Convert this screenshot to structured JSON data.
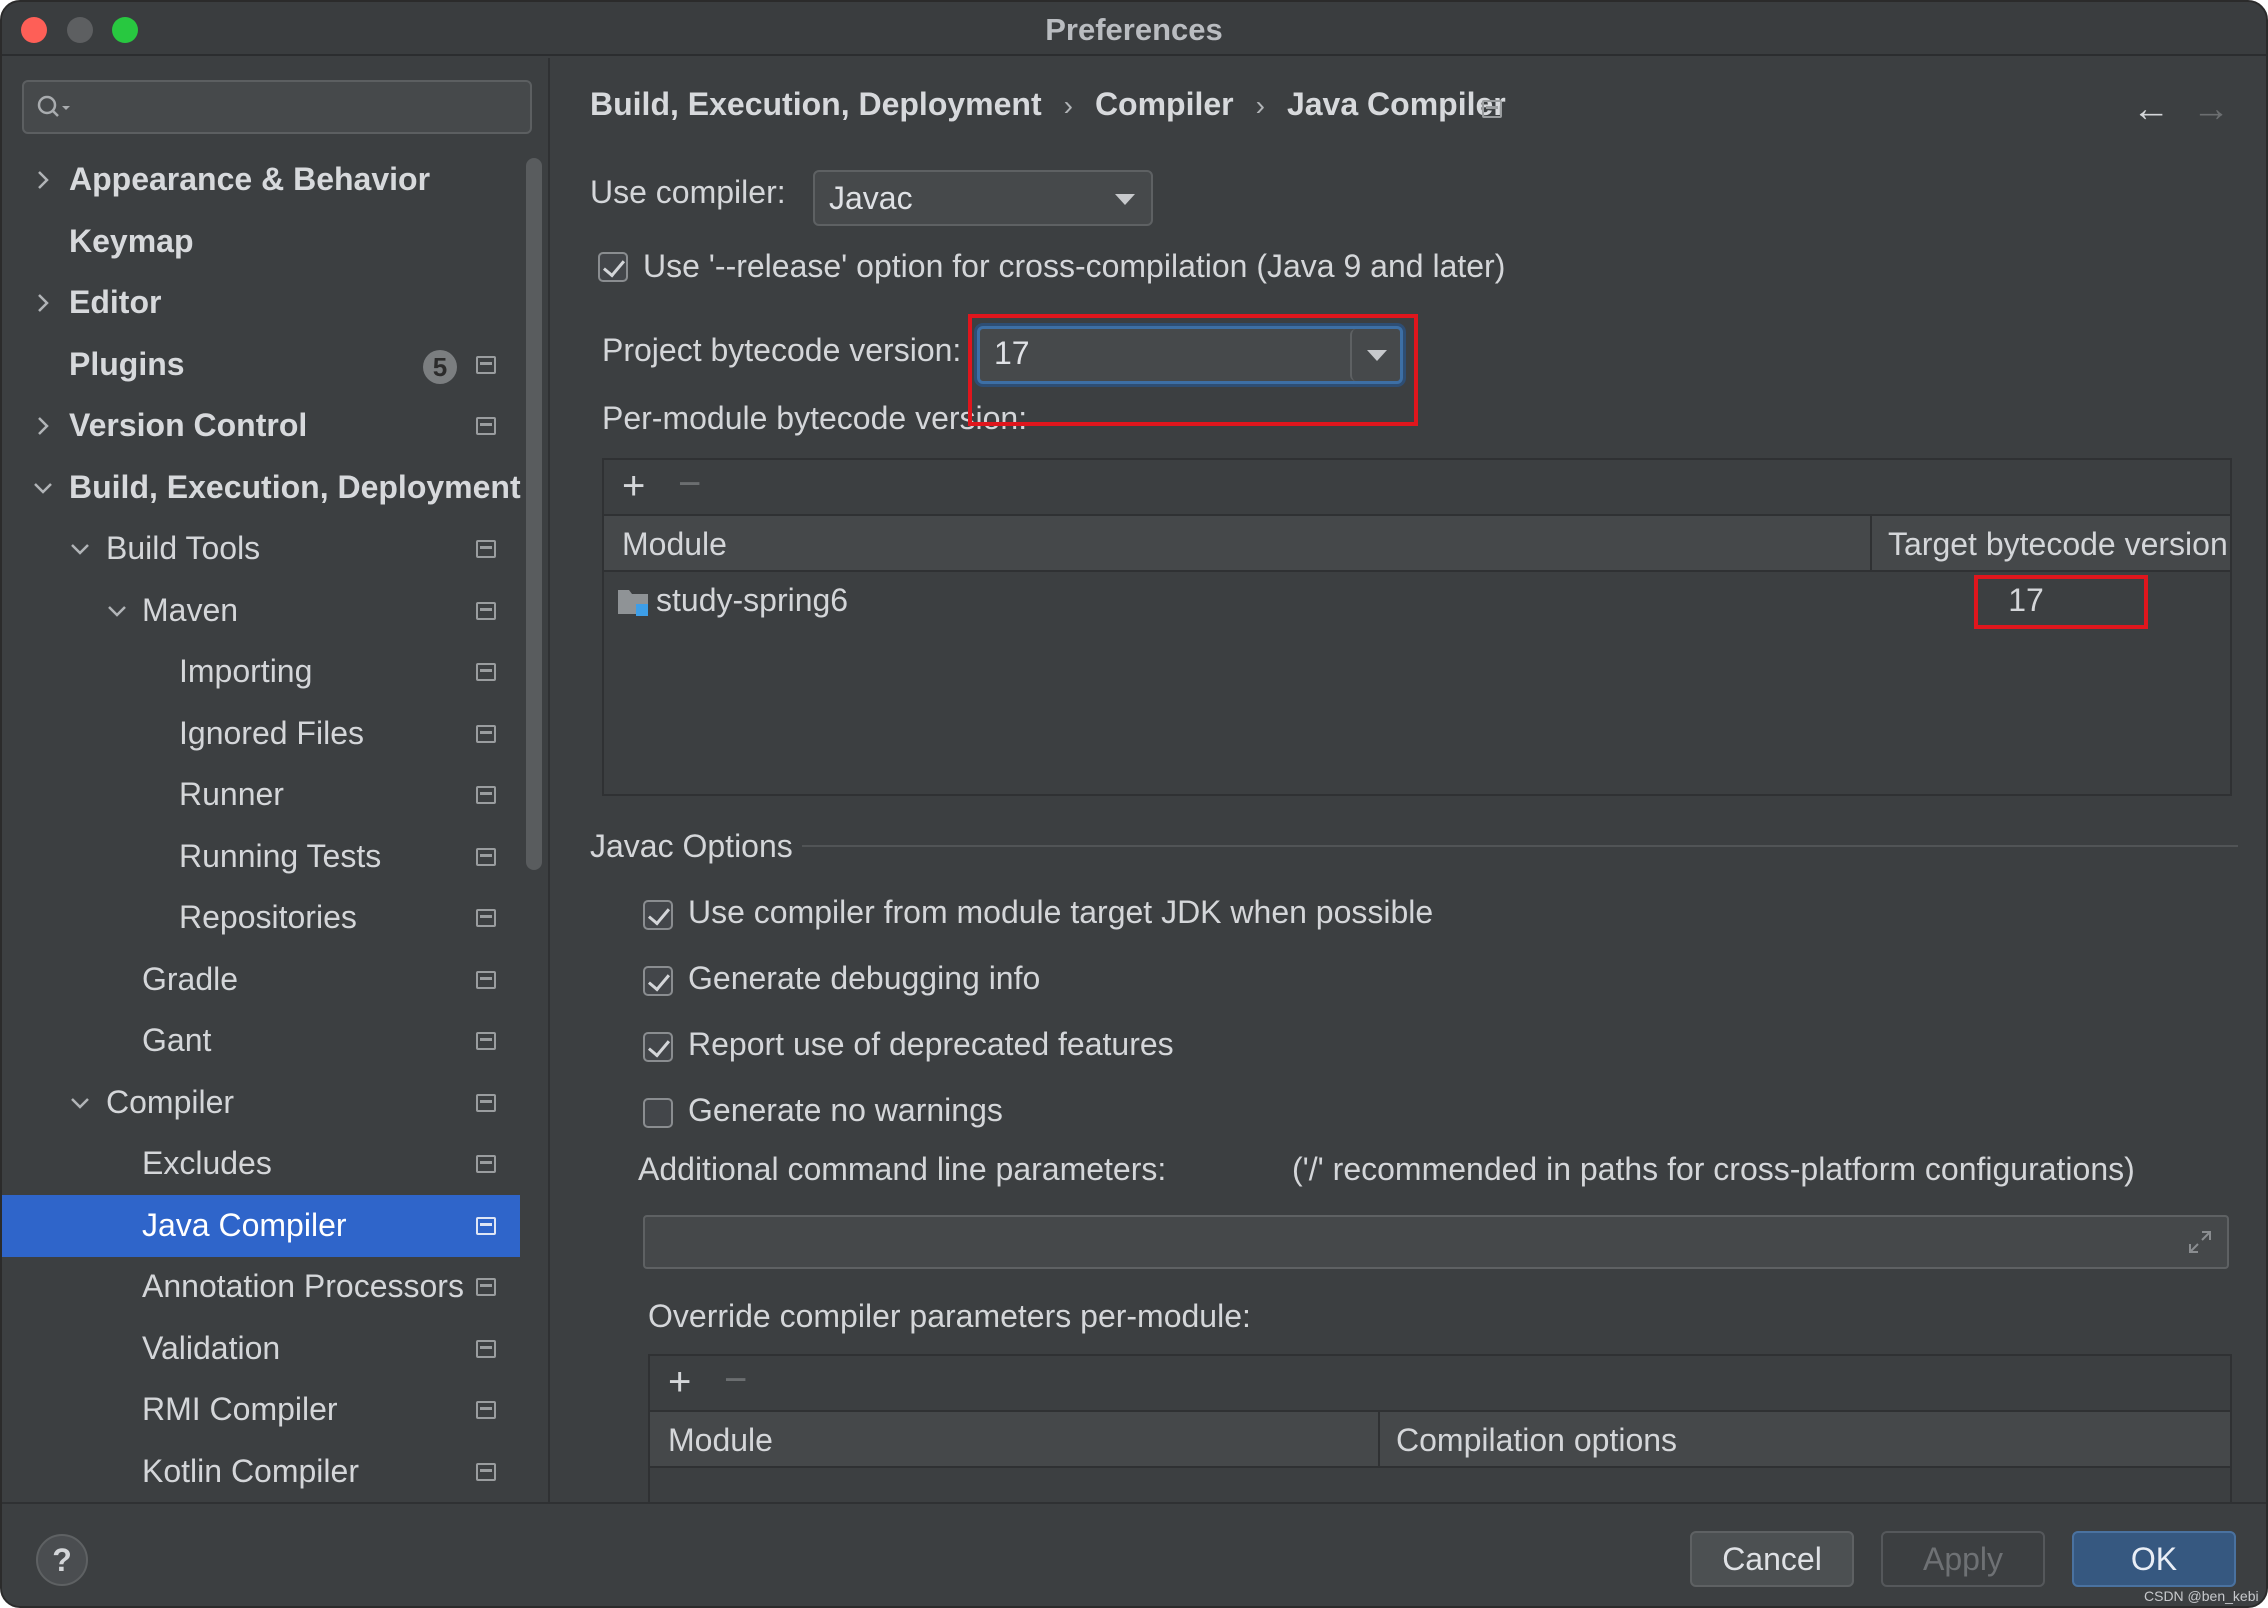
{
  "window": {
    "title": "Preferences"
  },
  "sidebar": {
    "search_placeholder": "",
    "badge_count": "5",
    "items": [
      {
        "label": "Appearance & Behavior"
      },
      {
        "label": "Keymap"
      },
      {
        "label": "Editor"
      },
      {
        "label": "Plugins"
      },
      {
        "label": "Version Control"
      },
      {
        "label": "Build, Execution, Deployment"
      },
      {
        "label": "Build Tools"
      },
      {
        "label": "Maven"
      },
      {
        "label": "Importing"
      },
      {
        "label": "Ignored Files"
      },
      {
        "label": "Runner"
      },
      {
        "label": "Running Tests"
      },
      {
        "label": "Repositories"
      },
      {
        "label": "Gradle"
      },
      {
        "label": "Gant"
      },
      {
        "label": "Compiler"
      },
      {
        "label": "Excludes"
      },
      {
        "label": "Java Compiler"
      },
      {
        "label": "Annotation Processors"
      },
      {
        "label": "Validation"
      },
      {
        "label": "RMI Compiler"
      },
      {
        "label": "Kotlin Compiler"
      }
    ],
    "selected": "Java Compiler"
  },
  "breadcrumb": {
    "items": [
      "Build, Execution, Deployment",
      "Compiler",
      "Java Compiler"
    ],
    "separator": "›"
  },
  "compiler": {
    "use_compiler_label": "Use compiler:",
    "use_compiler_value": "Javac",
    "release_option_label": "Use '--release' option for cross-compilation (Java 9 and later)",
    "release_option_checked": true,
    "project_bytecode_label": "Project bytecode version:",
    "project_bytecode_value": "17",
    "per_module_label": "Per-module bytecode version:",
    "module_table": {
      "columns": [
        "Module",
        "Target bytecode version"
      ],
      "rows": [
        {
          "module": "study-spring6",
          "target": "17"
        }
      ]
    }
  },
  "javac_options": {
    "section_title": "Javac Options",
    "checkboxes": [
      {
        "label": "Use compiler from module target JDK when possible",
        "checked": true
      },
      {
        "label": "Generate debugging info",
        "checked": true
      },
      {
        "label": "Report use of deprecated features",
        "checked": true
      },
      {
        "label": "Generate no warnings",
        "checked": false
      }
    ],
    "additional_params_label": "Additional command line parameters:",
    "additional_params_hint": "('/' recommended in paths for cross-platform configurations)",
    "additional_params_value": "",
    "override_label": "Override compiler parameters per-module:",
    "override_table": {
      "columns": [
        "Module",
        "Compilation options"
      ]
    }
  },
  "footer": {
    "help": "?",
    "cancel": "Cancel",
    "apply": "Apply",
    "ok": "OK",
    "watermark": "CSDN @ben_kebi"
  },
  "colors": {
    "window_bg": "#3c3f41",
    "selection": "#2f65ca",
    "highlight_red": "#e0161d",
    "ok_button": "#365880"
  }
}
